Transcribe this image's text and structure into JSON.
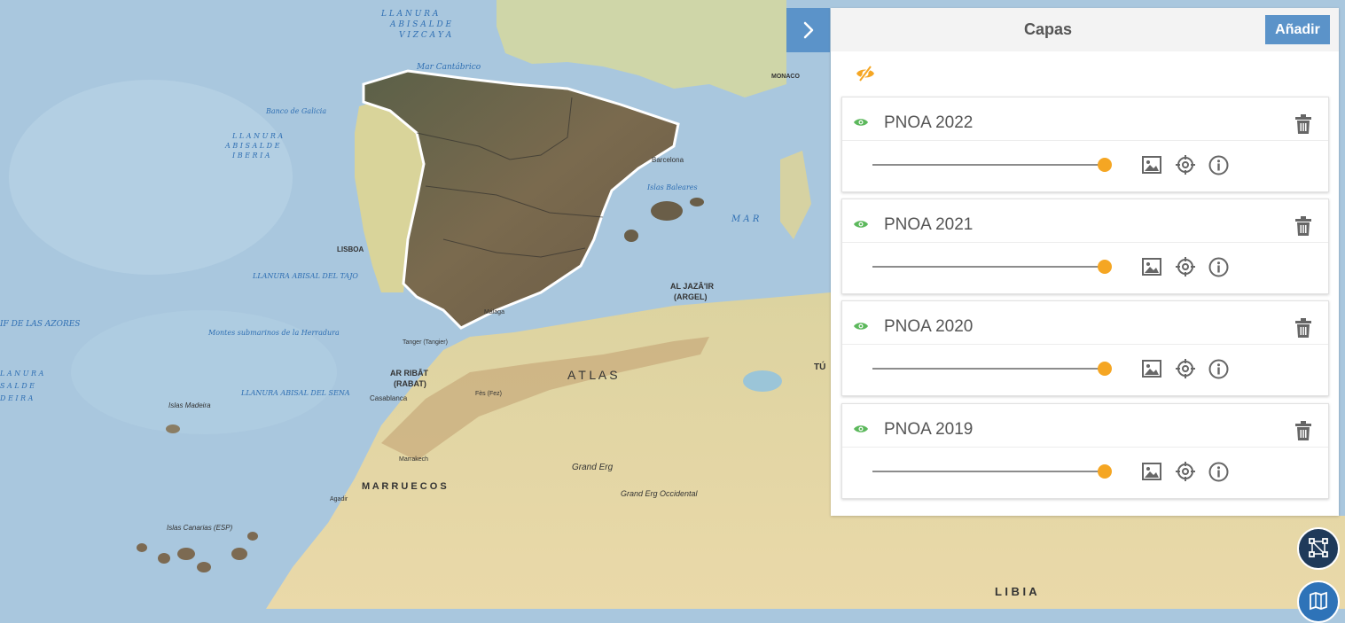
{
  "map": {
    "labels": {
      "vizcaya_1": "L L A N U R A",
      "vizcaya_2": "A B I S A L  D E",
      "vizcaya_3": "V I Z C A Y A",
      "mar_cantabrico": "Mar Cantábrico",
      "banco_galicia": "Banco de Galicia",
      "iberia_1": "L L A N U R A",
      "iberia_2": "A B I S A L  D E",
      "iberia_3": "I B E R I A",
      "lisboa": "LISBOA",
      "tajo": "LLANURA ABISAL DEL TAJO",
      "azores": "IF DE LAS AZORES",
      "montes": "Montes submarinos de la Herradura",
      "llanura_left_1": "L A N U R A",
      "llanura_left_2": "S A L  D E",
      "llanura_left_3": "D E I R A",
      "sena": "LLANURA ABISAL DEL SENA",
      "rabat_1": "AR RIBĀT",
      "rabat_2": "(RABAT)",
      "casablanca": "Casablanca",
      "madeira": "Islas Madeira",
      "marruecos": "M A R R U E C O S",
      "canarias": "Islas Canarias (ESP)",
      "argel_1": "AL JAZĀ'IR",
      "argel_2": "(ARGEL)",
      "barcelona": "Barcelona",
      "baleares": "Islas Baleares",
      "mar_right": "M A R",
      "atlas": "A T L A S",
      "grand_erg": "Grand Erg",
      "grand_erg_occ": "Grand Erg Occidental",
      "libia": "L I B I A",
      "tunez": "TÚ",
      "monaco": "MONACO",
      "malaga": "Málaga",
      "tanger": "Tanger (Tangier)",
      "fes": "Fès (Fez)",
      "marrakech": "Marrakech",
      "agadir": "Agadir"
    }
  },
  "panel": {
    "title": "Capas",
    "add_label": "Añadir",
    "layers": [
      {
        "name": "PNOA 2022",
        "opacity": 1.0
      },
      {
        "name": "PNOA 2021",
        "opacity": 1.0
      },
      {
        "name": "PNOA 2020",
        "opacity": 1.0
      },
      {
        "name": "PNOA 2019",
        "opacity": 1.0
      }
    ]
  },
  "colors": {
    "accent": "#5b93c9",
    "slider_thumb": "#f5a623",
    "visible_eye": "#5cb85c",
    "hide_all_icon": "#f5a623",
    "sea": "#a9c7de",
    "land": "#e8d9a8"
  },
  "icons": {
    "toggle": "chevron-right-icon",
    "hide_all": "eye-slash-icon",
    "visibility": "eye-icon",
    "delete": "trash-icon",
    "legend": "image-icon",
    "zoom": "crosshair-icon",
    "info": "info-icon",
    "draw": "draw-tool-icon",
    "basemap": "map-icon"
  }
}
